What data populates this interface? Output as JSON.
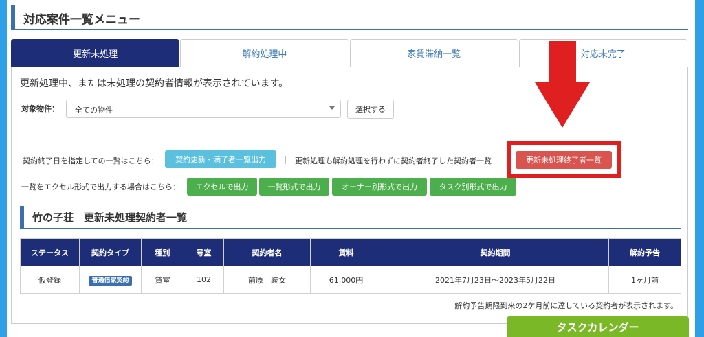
{
  "header": {
    "title": "対応案件一覧メニュー"
  },
  "tabs": [
    {
      "label": "更新未処理",
      "active": true
    },
    {
      "label": "解約処理中",
      "active": false
    },
    {
      "label": "家賃滞納一覧",
      "active": false
    },
    {
      "label": "対応未完了",
      "active": false
    }
  ],
  "panel": {
    "description": "更新処理中、または未処理の契約者情報が表示されています。",
    "filter_label": "対象物件：",
    "filter_value": "全ての物件",
    "select_button": "選択する"
  },
  "line1": {
    "label": "契約終了日を指定しての一覧はこちら：",
    "button": "契約更新・満了者一覧出力",
    "separator": "|",
    "label2": "更新処理も解約処理を行わずに契約者終了した契約者一覧",
    "highlight_button": "更新未処理終了者一覧"
  },
  "line2": {
    "label": "一覧をエクセル形式で出力する場合はこちら：",
    "buttons": [
      "エクセルで出力",
      "一覧形式で出力",
      "オーナー別形式で出力",
      "タスク別形式で出力"
    ]
  },
  "subsection": {
    "title": "竹の子荘　更新未処理契約者一覧"
  },
  "table": {
    "headers": [
      "ステータス",
      "契約タイプ",
      "種別",
      "号室",
      "契約者名",
      "賃料",
      "契約期間",
      "解約予告"
    ],
    "rows": [
      [
        "仮登録",
        "普通借家契約",
        "貸室",
        "102",
        "前原　綾女",
        "61,000円",
        "2021年7月23日～2023年5月22日",
        "1ヶ月前"
      ]
    ]
  },
  "note": "解約予告期限到来の2ケ月前に達している契約者が表示されます。",
  "calendar_button": "タスクカレンダー",
  "colors": {
    "accent": "#1d2d78",
    "highlight": "#e02020",
    "green": "#4cae4c",
    "cyan": "#5bc0de"
  }
}
